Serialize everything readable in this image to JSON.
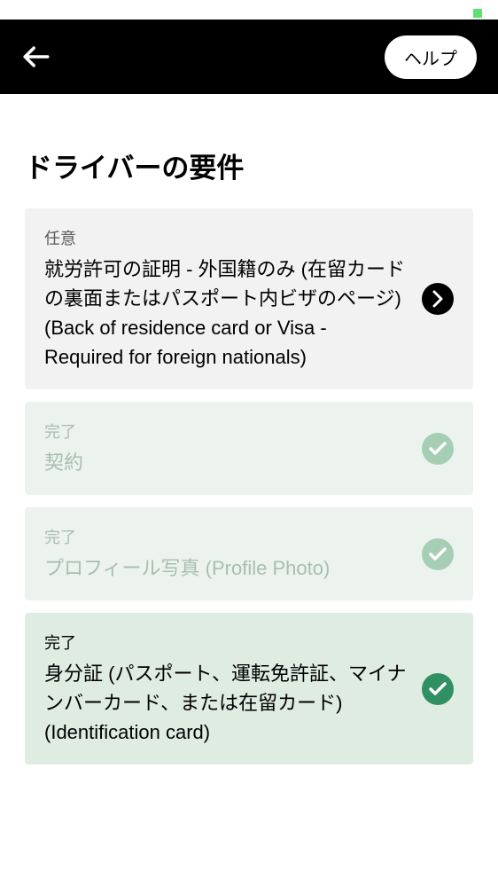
{
  "header": {
    "help_label": "ヘルプ"
  },
  "page_title": "ドライバーの要件",
  "cards": [
    {
      "status": "任意",
      "title": "就労許可の証明 - 外国籍のみ (在留カードの裏面またはパスポート内ビザのページ) (Back of residence card or Visa - Required for foreign nationals)"
    },
    {
      "status": "完了",
      "title": "契約"
    },
    {
      "status": "完了",
      "title": "プロフィール写真 (Profile Photo)"
    },
    {
      "status": "完了",
      "title": "身分証 (パスポート、運転免許証、マイナンバーカード、または在留カード) (Identification card)"
    }
  ]
}
